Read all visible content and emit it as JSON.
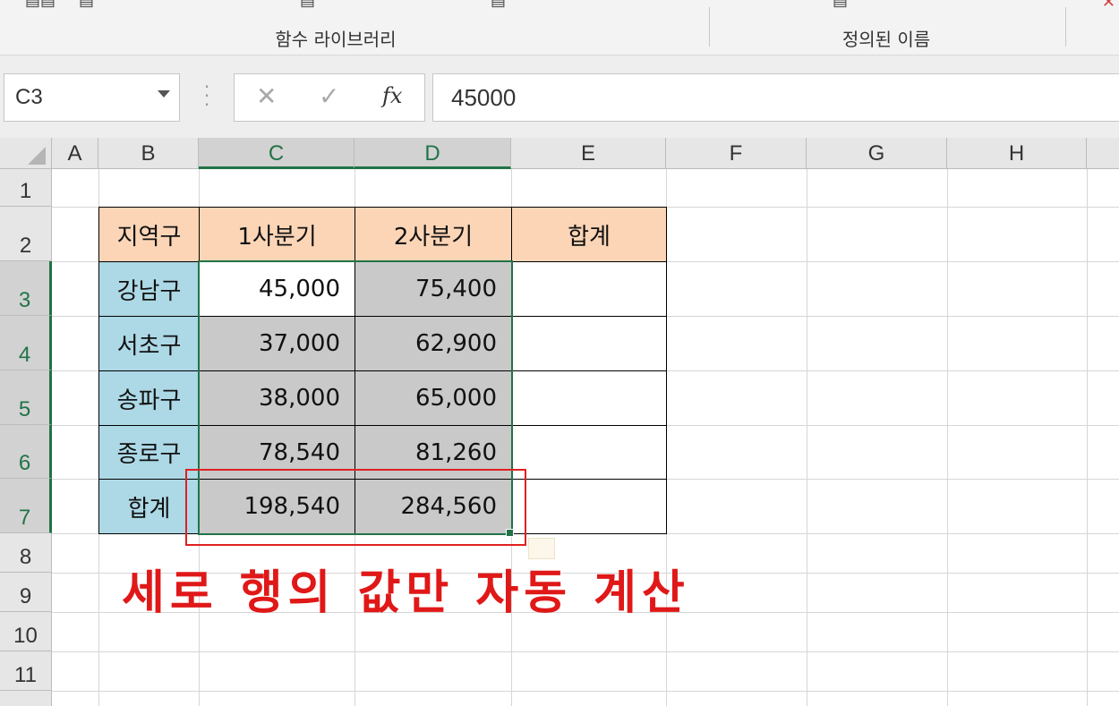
{
  "ribbon": {
    "groups": [
      {
        "label": "함수 라이브러리"
      },
      {
        "label": "정의된 이름"
      }
    ]
  },
  "formula_bar": {
    "name_box": "C3",
    "cancel_icon": "✕",
    "enter_icon": "✓",
    "fx_label": "fx",
    "formula_value": "45000"
  },
  "columns": [
    "A",
    "B",
    "C",
    "D",
    "E",
    "F",
    "G",
    "H"
  ],
  "selected_columns": [
    "C",
    "D"
  ],
  "rows": [
    "1",
    "2",
    "3",
    "4",
    "5",
    "6",
    "7",
    "8",
    "9",
    "10",
    "11"
  ],
  "selected_rows": [
    "3",
    "4",
    "5",
    "6",
    "7"
  ],
  "table": {
    "headers": [
      "지역구",
      "1사분기",
      "2사분기",
      "합계"
    ],
    "rows": [
      {
        "district": "강남구",
        "q1": "45,000",
        "q2": "75,400",
        "total": ""
      },
      {
        "district": "서초구",
        "q1": "37,000",
        "q2": "62,900",
        "total": ""
      },
      {
        "district": "송파구",
        "q1": "38,000",
        "q2": "65,000",
        "total": ""
      },
      {
        "district": "종로구",
        "q1": "78,540",
        "q2": "81,260",
        "total": ""
      }
    ],
    "sum_row": {
      "label": "합계",
      "q1": "198,540",
      "q2": "284,560",
      "total": ""
    }
  },
  "annotation": "세로 행의 값만 자동 계산",
  "colors": {
    "header_fill": "#fbd5b6",
    "district_fill": "#add8e6",
    "selected_fill": "#c9c9c9",
    "selection_border": "#217346",
    "annotation": "#e01818"
  }
}
